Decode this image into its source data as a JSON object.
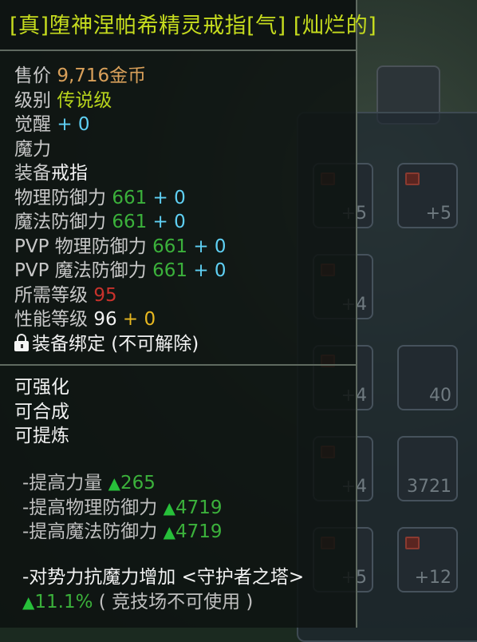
{
  "item": {
    "title": "[真]堕神涅帕希精灵戒指[气] [灿烂的]",
    "price_label": "售价",
    "price_value": "9,716金币",
    "level_label": "级别",
    "level_value": "传说级",
    "awaken_label": "觉醒",
    "awaken_value": "+ 0",
    "magic_label": "魔力",
    "equip_label": "装备",
    "equip_value": "戒指",
    "phys_def_label": "物理防御力",
    "phys_def_value": "661",
    "phys_def_bonus": "+ 0",
    "mag_def_label": "魔法防御力",
    "mag_def_value": "661",
    "mag_def_bonus": "+ 0",
    "pvp_phys_label": "PVP 物理防御力",
    "pvp_phys_value": "661",
    "pvp_phys_bonus": "+ 0",
    "pvp_mag_label": "PVP 魔法防御力",
    "pvp_mag_value": "661",
    "pvp_mag_bonus": "+ 0",
    "req_level_label": "所需等级",
    "req_level_value": "95",
    "perf_level_label": "性能等级",
    "perf_level_value": "96",
    "perf_level_bonus": "+ 0",
    "bind_text": "装备绑定 (不可解除)"
  },
  "abilities": [
    "可强化",
    "可合成",
    "可提炼"
  ],
  "bonuses": [
    {
      "label": "-提高力量 ",
      "value": "265"
    },
    {
      "label": "-提高物理防御力 ",
      "value": "4719"
    },
    {
      "label": "-提高魔法防御力 ",
      "value": "4719"
    }
  ],
  "special": {
    "line1": "-对势力抗魔力增加 <守护者之塔>",
    "value": "11.1%",
    "note": "( 竞技场不可使用 )"
  },
  "background_slots": [
    {
      "count": "+5"
    },
    {
      "count": "+5"
    },
    {
      "count": "+4"
    },
    {
      "count": "+4"
    },
    {
      "count": "40"
    },
    {
      "count": "+4"
    },
    {
      "count": "3721"
    },
    {
      "count": "+5"
    },
    {
      "count": "+12"
    }
  ],
  "icons": {
    "lock": "lock-icon",
    "up": "triangle-up-icon"
  },
  "colors": {
    "title": "#c6dc1e",
    "price": "#d9a05a",
    "legendary": "#b8d41c",
    "awaken": "#5fd0f4",
    "stat_value": "#3bb13b",
    "required_level": "#c8322c",
    "performance_bonus": "#e8b820",
    "bonus_up": "#27c03a"
  }
}
